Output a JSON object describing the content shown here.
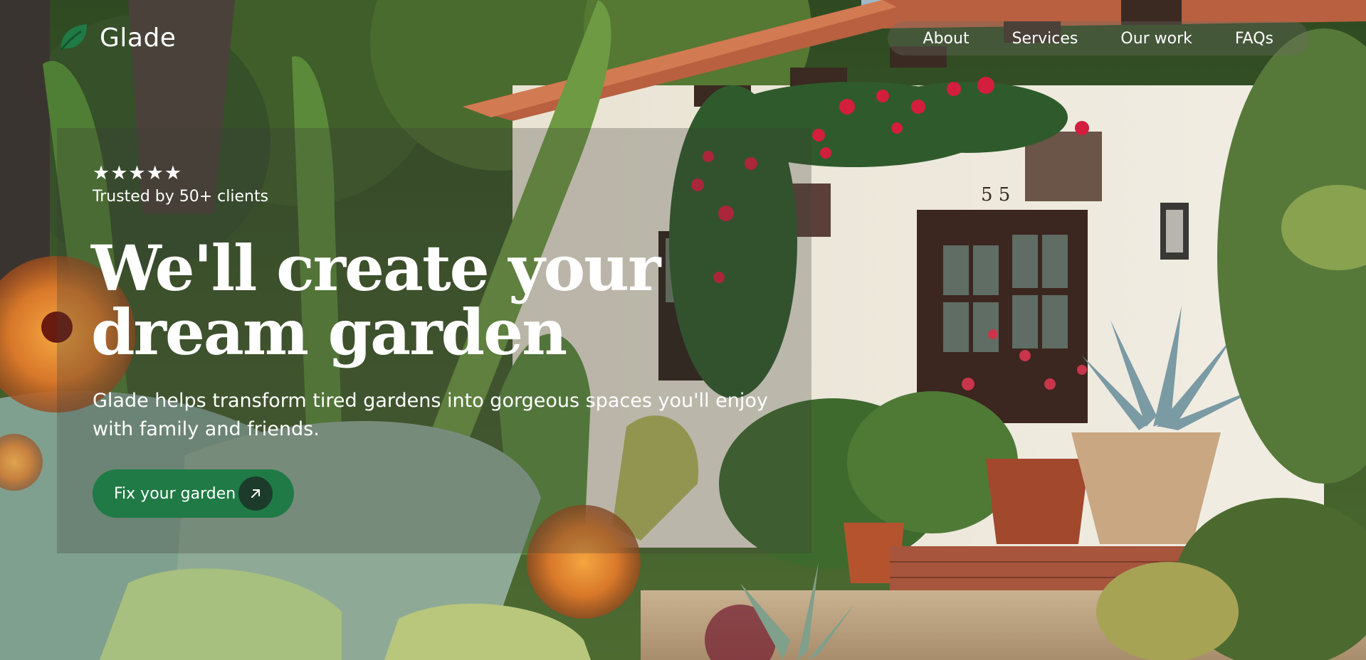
{
  "brand": {
    "name": "Glade",
    "icon": "leaf-icon",
    "accent": "#1f7a45"
  },
  "nav": {
    "items": [
      {
        "label": "About"
      },
      {
        "label": "Services"
      },
      {
        "label": "Our work"
      },
      {
        "label": "FAQs"
      }
    ]
  },
  "hero": {
    "rating": {
      "stars": "★★★★★",
      "value": 5,
      "max": 5
    },
    "trusted_text": "Trusted by 50+ clients",
    "headline_line1": "We'll create your",
    "headline_line2": "dream garden",
    "subtitle": "Glade helps transform tired gardens into gorgeous spaces you'll enjoy with family and friends.",
    "cta": {
      "label": "Fix your garden",
      "icon": "arrow-up-right-icon",
      "color": "#1f7a45"
    }
  },
  "background": {
    "house_number": "55",
    "description_icon": "garden-photo"
  }
}
